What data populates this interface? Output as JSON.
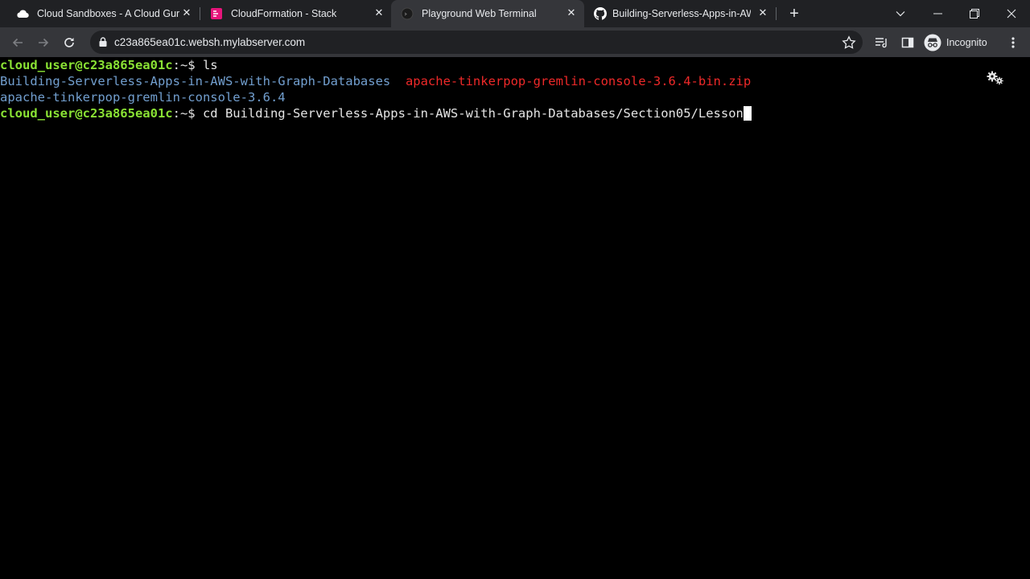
{
  "browser": {
    "tabs": [
      {
        "title": "Cloud Sandboxes - A Cloud Guru",
        "favicon": "cloud-icon",
        "active": false
      },
      {
        "title": "CloudFormation - Stack",
        "favicon": "cloudformation-icon",
        "active": false
      },
      {
        "title": "Playground Web Terminal",
        "favicon": "terminal-globe-icon",
        "active": true
      },
      {
        "title": "Building-Serverless-Apps-in-AWS",
        "favicon": "github-icon",
        "active": false
      }
    ],
    "url": "c23a865ea01c.websh.mylabserver.com",
    "profile_label": "Incognito"
  },
  "terminal": {
    "lines": [
      {
        "prompt": "cloud_user@c23a865ea01c",
        "sep": ":~$ ",
        "command": "ls"
      },
      {
        "dir": "Building-Serverless-Apps-in-AWS-with-Graph-Databases",
        "gap": "  ",
        "file": "apache-tinkerpop-gremlin-console-3.6.4-bin.zip"
      },
      {
        "dir": "apache-tinkerpop-gremlin-console-3.6.4"
      },
      {
        "prompt": "cloud_user@c23a865ea01c",
        "sep": ":~$ ",
        "command": "cd Building-Serverless-Apps-in-AWS-with-Graph-Databases/Section05/Lesson"
      }
    ]
  },
  "colors": {
    "prompt": "#8ae234",
    "directory": "#729fcf",
    "archive": "#ef2929",
    "tab_strip": "#202124",
    "toolbar": "#35363a"
  }
}
